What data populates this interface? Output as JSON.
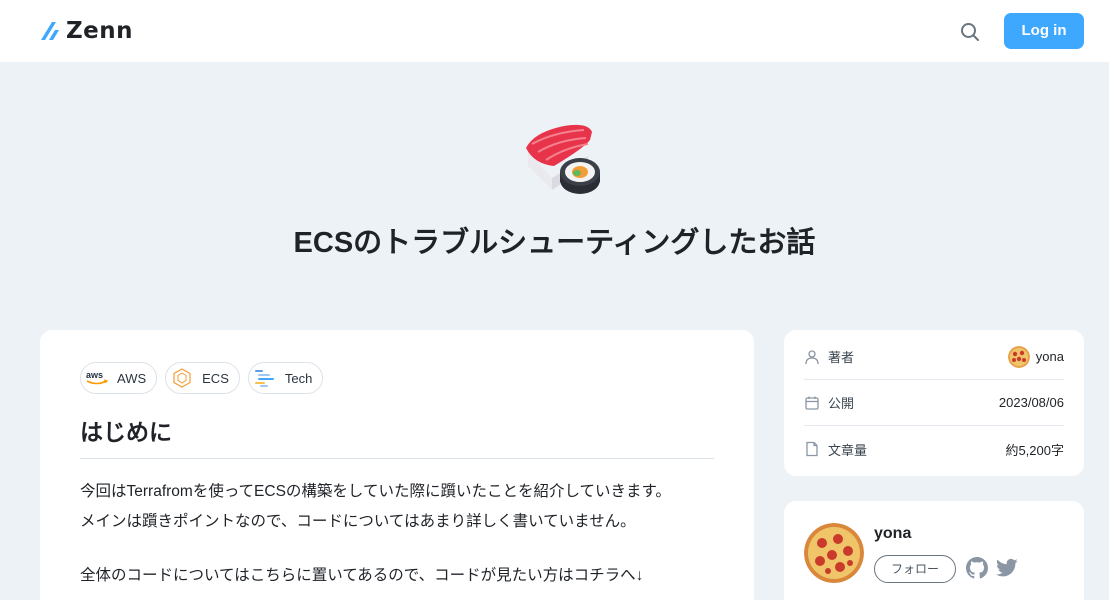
{
  "header": {
    "logo_text": "Zenn",
    "login_label": "Log in"
  },
  "article": {
    "emoji": "sushi",
    "title": "ECSのトラブルシューティングしたお話",
    "topics": [
      {
        "label": "AWS",
        "icon": "aws-icon"
      },
      {
        "label": "ECS",
        "icon": "ecs-icon"
      },
      {
        "label": "Tech",
        "icon": "tech-icon"
      }
    ],
    "heading": "はじめに",
    "paragraph1_line1": "今回はTerrafromを使ってECSの構築をしていた際に躓いたことを紹介していきます。",
    "paragraph1_line2": "メインは躓きポイントなので、コードについてはあまり詳しく書いていません。",
    "paragraph2": "全体のコードについてはこちらに置いてあるので、コードが見たい方はコチラへ↓"
  },
  "info": {
    "author_label": "著者",
    "author_value": "yona",
    "published_label": "公開",
    "published_value": "2023/08/06",
    "length_label": "文章量",
    "length_value": "約5,200字"
  },
  "author_card": {
    "name": "yona",
    "follow_label": "フォロー"
  },
  "colors": {
    "accent": "#3ea8ff",
    "background": "#edf2f7"
  }
}
